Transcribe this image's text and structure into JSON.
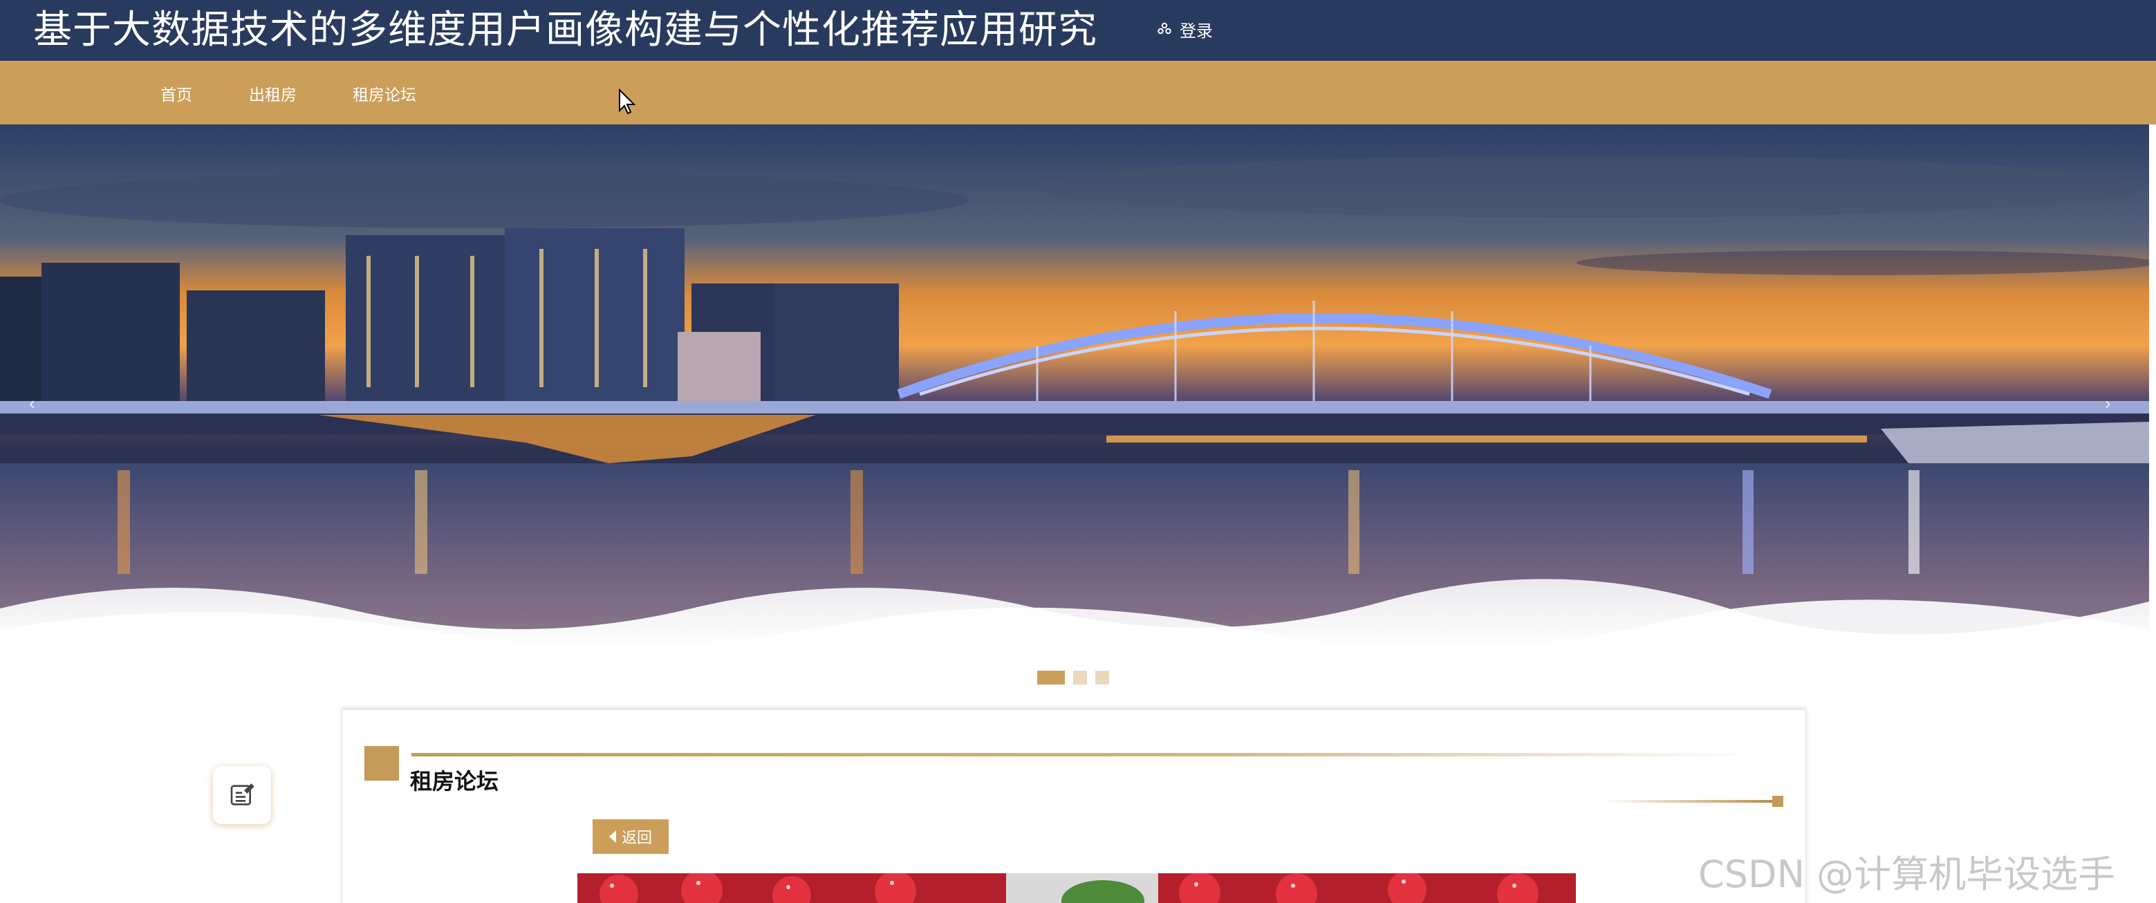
{
  "header": {
    "site_title": "基于大数据技术的多维度用户画像构建与个性化推荐应用研究",
    "login_label": "登录",
    "login_icon": "user-group-icon"
  },
  "nav": {
    "items": [
      {
        "label": "首页"
      },
      {
        "label": "出租房"
      },
      {
        "label": "租房论坛"
      }
    ]
  },
  "banner": {
    "image": "night-city-bridge-skyline",
    "slides_total": 3,
    "active_slide": 1,
    "prev_arrow": "‹",
    "next_arrow": "›"
  },
  "content": {
    "section_title": "租房论坛",
    "back_label": "返回",
    "post_image": "strawberries-photo"
  },
  "side_button": {
    "icon": "edit-note-icon"
  },
  "watermark": "CSDN @计算机毕设选手",
  "colors": {
    "header_bg": "#283a5e",
    "nav_bg": "#cb9f5a",
    "accent": "#c49a58"
  }
}
